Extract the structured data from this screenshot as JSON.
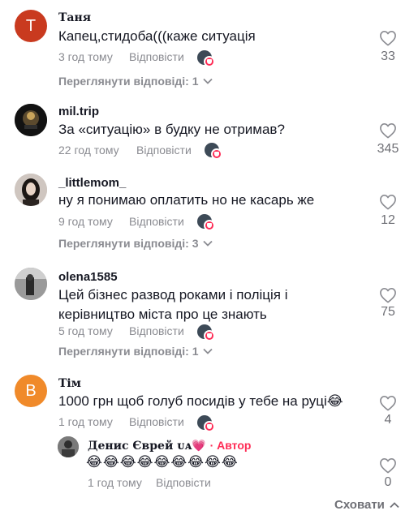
{
  "comments": [
    {
      "username": "Таня",
      "avatar_letter": "Т",
      "avatar_color": "#c93a1f",
      "text": "Капец,стидоба(((каже ситуація",
      "time": "3 год тому",
      "reply_label": "Відповісти",
      "likes": "33",
      "view_replies": "Переглянути відповіді: 1"
    },
    {
      "username": "mil.trip",
      "text": "За «ситуацію» в будку не отримав?",
      "time": "22 год тому",
      "reply_label": "Відповісти",
      "likes": "345"
    },
    {
      "username": "_littlemom_",
      "text": "ну я понимаю оплатить но не касарь же",
      "time": "9 год тому",
      "reply_label": "Відповісти",
      "likes": "12",
      "view_replies": "Переглянути відповіді: 3"
    },
    {
      "username": "olena1585",
      "text": "Цей бізнес развод роками і поліція і керівництво міста про це знають",
      "time": "5 год тому",
      "reply_label": "Відповісти",
      "likes": "75",
      "view_replies": "Переглянути відповіді: 1"
    },
    {
      "username": "Тім",
      "avatar_letter": "В",
      "avatar_color": "#f08a2a",
      "text": "1000 грн щоб голуб посидів у тебе на руці😂",
      "time": "1 год тому",
      "reply_label": "Відповісти",
      "likes": "4"
    }
  ],
  "reply": {
    "username": "Денис Єврей ᴜᴀ💗",
    "author_tag": "· Автор",
    "text": "😂😂😂😂😂😂😂😂😂",
    "time": "1 год тому",
    "reply_label": "Відповісти",
    "likes": "0"
  },
  "hide_label": "Сховати",
  "colors": {
    "accent": "#fe2c55",
    "muted": "#8a8b91"
  },
  "icons": [
    "heart-outline-icon",
    "chevron-down-icon",
    "chevron-up-icon",
    "creator-liked-icon"
  ]
}
